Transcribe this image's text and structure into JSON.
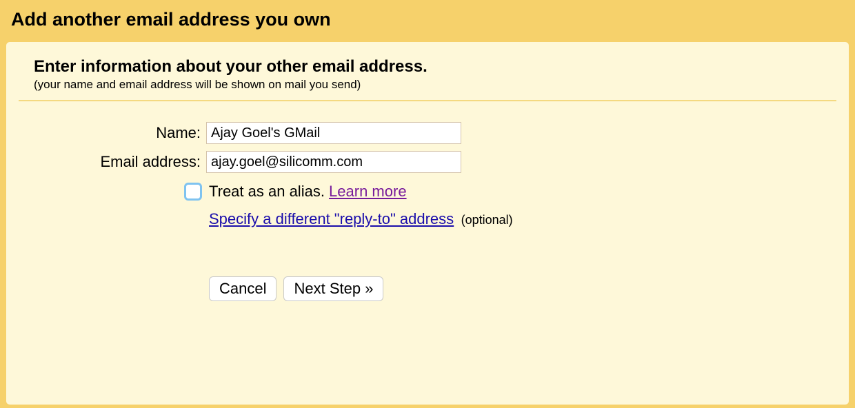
{
  "dialog": {
    "title": "Add another email address you own"
  },
  "info": {
    "heading": "Enter information about your other email address.",
    "subheading": "(your name and email address will be shown on mail you send)"
  },
  "form": {
    "name_label": "Name:",
    "name_value": "Ajay Goel's GMail",
    "email_label": "Email address:",
    "email_value": "ajay.goel@silicomm.com",
    "alias_text": "Treat as an alias. ",
    "learn_more": "Learn more",
    "reply_to_link": "Specify a different \"reply-to\" address",
    "optional": "(optional)"
  },
  "buttons": {
    "cancel": "Cancel",
    "next": "Next Step »"
  }
}
